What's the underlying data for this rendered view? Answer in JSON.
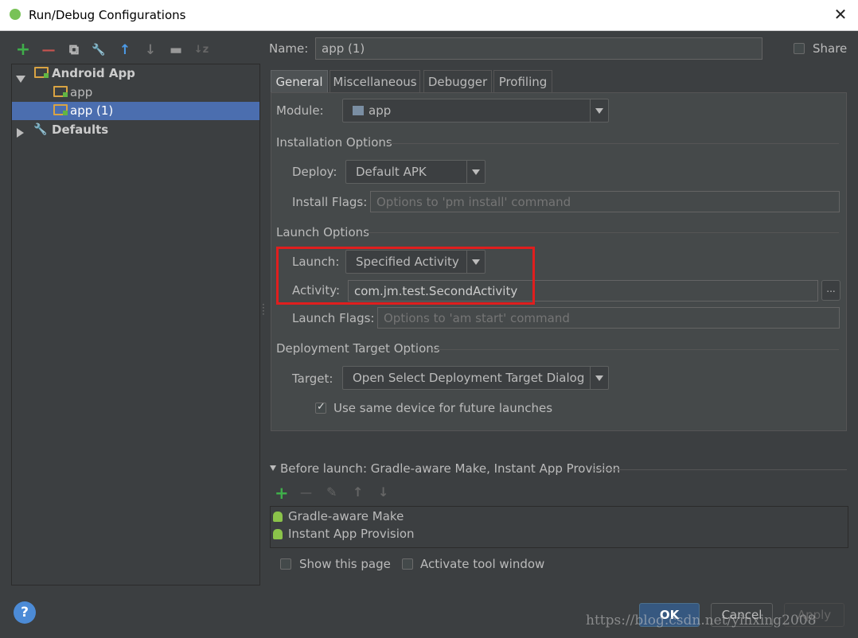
{
  "window": {
    "title": "Run/Debug Configurations",
    "close": "✕"
  },
  "toolbar": {
    "add": "+",
    "remove": "—",
    "copy": "⧉",
    "edit_defaults": "🔧",
    "move_up": "↑",
    "move_down": "↓",
    "folder": "▬",
    "sort": "↓z"
  },
  "tree": {
    "items": [
      {
        "label": "Android App"
      },
      {
        "label": "app"
      },
      {
        "label": "app (1)"
      },
      {
        "label": "Defaults"
      }
    ]
  },
  "name": {
    "label": "Name:",
    "value": "app (1)",
    "share_label": "Share"
  },
  "tabs": [
    "General",
    "Miscellaneous",
    "Debugger",
    "Profiling"
  ],
  "general": {
    "module": {
      "label": "Module:",
      "value": "app"
    },
    "installation_title": "Installation Options",
    "deploy": {
      "label": "Deploy:",
      "value": "Default APK"
    },
    "install_flags": {
      "label": "Install Flags:",
      "placeholder": "Options to 'pm install' command"
    },
    "launch_title": "Launch Options",
    "launch": {
      "label": "Launch:",
      "value": "Specified Activity"
    },
    "activity": {
      "label": "Activity:",
      "value": "com.jm.test.SecondActivity",
      "browse": "..."
    },
    "launch_flags": {
      "label": "Launch Flags:",
      "placeholder": "Options to 'am start' command"
    },
    "deployment_title": "Deployment Target Options",
    "target": {
      "label": "Target:",
      "value": "Open Select Deployment Target Dialog"
    },
    "same_device": {
      "label": "Use same device for future launches",
      "checked": true
    }
  },
  "before_launch": {
    "title": "Before launch: Gradle-aware Make, Instant App Provision",
    "tools": {
      "add": "+",
      "remove": "—",
      "edit": "✎",
      "up": "↑",
      "down": "↓"
    },
    "items": [
      "Gradle-aware Make",
      "Instant App Provision"
    ]
  },
  "footer": {
    "show_page": "Show this page",
    "activate_tool": "Activate tool window",
    "help": "?",
    "ok": "OK",
    "cancel": "Cancel",
    "apply": "Apply"
  },
  "watermark": "https://blog.csdn.net/yinxing2008",
  "colors": {
    "accent": "#4b6eaf",
    "highlight_box": "#e01e1e",
    "ok_button": "#365880",
    "add_green": "#3fae4a",
    "remove_red": "#c75450"
  }
}
